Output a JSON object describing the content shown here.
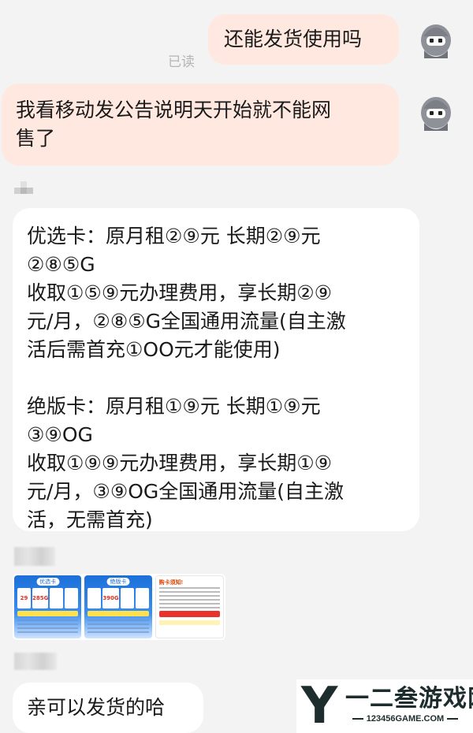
{
  "messages": [
    {
      "side": "me",
      "text": "还能发货使用吗"
    },
    {
      "status": "已读"
    },
    {
      "side": "me",
      "lines": [
        "我看移动发公告说明天开始就不能网",
        "售了"
      ]
    },
    {
      "side": "them",
      "lines": [
        "优选卡：原月租②⑨元  长期②⑨元",
        "②⑧⑤G",
        "收取①⑤⑨元办理费用，享长期②⑨",
        "元/月，②⑧⑤G全国通用流量(自主激",
        "活后需首充①OO元才能使用)",
        "",
        "绝版卡：原月租①⑨元  长期①⑨元",
        "③⑨OG",
        "收取①⑨⑨元办理费用，享长期①⑨",
        "元/月，③⑨OG全国通用流量(自主激",
        "活，无需首充)"
      ]
    },
    {
      "side": "them",
      "type": "image",
      "posters": [
        {
          "tag": "优选卡",
          "cells": [
            "29",
            "285G",
            "",
            ""
          ]
        },
        {
          "tag": "绝版卡",
          "cells": [
            "",
            "390G",
            "",
            ""
          ]
        },
        {
          "title": "购卡须知!"
        }
      ]
    },
    {
      "side": "them",
      "text": "亲可以发货的哈"
    }
  ],
  "watermark": {
    "logo": "Y",
    "name": "一二叁游戏网",
    "url": "123456GAME.COM"
  },
  "colors": {
    "background": "#f3f3f3",
    "my_bubble": "#ffe8e0",
    "their_bubble": "#ffffff",
    "read_status": "#b5b5b5"
  },
  "icons": [
    "user-avatar-icon"
  ]
}
